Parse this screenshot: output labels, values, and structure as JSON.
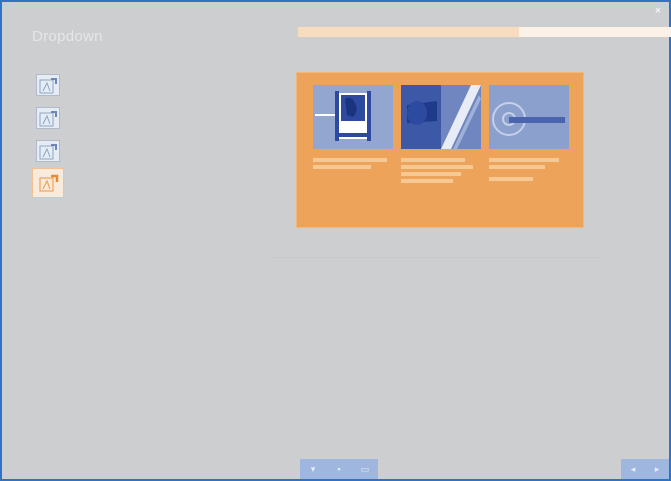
{
  "window": {
    "title": "Dropdown"
  },
  "progress": {
    "fraction": 0.59
  },
  "sidebar": {
    "items": [
      {
        "icon": "edit-document-icon",
        "active": false
      },
      {
        "icon": "edit-document-icon",
        "active": false
      },
      {
        "icon": "edit-document-icon",
        "active": false
      },
      {
        "icon": "edit-document-icon",
        "active": true
      }
    ]
  },
  "cards": [
    {
      "icon": "door-diagram-icon"
    },
    {
      "icon": "door-handle-photo-icon"
    },
    {
      "icon": "lock-handle-icon"
    }
  ],
  "colors": {
    "background": "#cdcecf",
    "accent_orange": "#eea35a",
    "accent_blue": "#8ea2ce",
    "frame_border": "#2f73c8"
  }
}
